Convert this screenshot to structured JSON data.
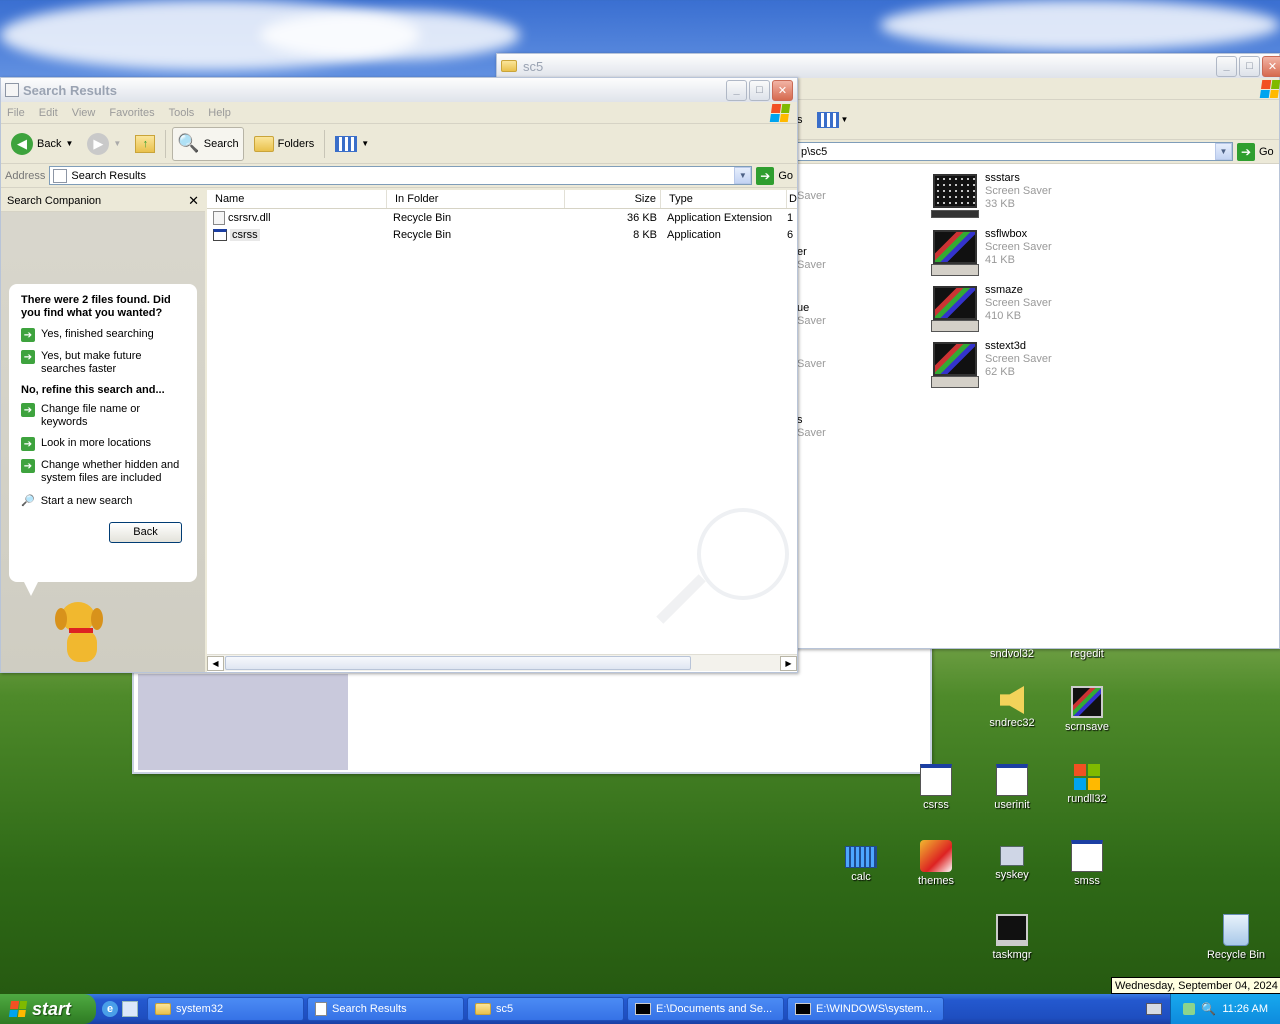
{
  "search_window": {
    "title": "Search Results",
    "menu": [
      "File",
      "Edit",
      "View",
      "Favorites",
      "Tools",
      "Help"
    ],
    "toolbar": {
      "back": "Back",
      "search": "Search",
      "folders": "Folders"
    },
    "address_label": "Address",
    "address_value": "Search Results",
    "go_label": "Go",
    "companion_title": "Search Companion",
    "companion": {
      "found_text": "There were 2 files found. Did you find what you wanted?",
      "yes_finished": "Yes, finished searching",
      "yes_faster": "Yes, but make future searches faster",
      "refine_title": "No, refine this search and...",
      "change_name": "Change file name or keywords",
      "look_more": "Look in more locations",
      "change_hidden": "Change whether hidden and system files are included",
      "start_new": "Start a new search",
      "back_button": "Back"
    },
    "columns": [
      "Name",
      "In Folder",
      "Size",
      "Type",
      "D"
    ],
    "rows": [
      {
        "name": "csrsrv.dll",
        "folder": "Recycle Bin",
        "size": "36 KB",
        "type": "Application Extension",
        "d": "1"
      },
      {
        "name": "csrss",
        "folder": "Recycle Bin",
        "size": "8 KB",
        "type": "Application",
        "d": "6"
      }
    ]
  },
  "sc5_window": {
    "title": "sc5",
    "address_fragment": "p\\sc5",
    "go_label": "Go",
    "toolbar_fragment": "s",
    "left_fragments": [
      {
        "line1": "",
        "line2": "Saver"
      },
      {
        "line1": "er",
        "line2": "Saver"
      },
      {
        "line1": "ue",
        "line2": "Saver"
      },
      {
        "line1": "",
        "line2": "Saver"
      },
      {
        "line1": "s",
        "line2": "Saver"
      }
    ],
    "items": [
      {
        "name": "ssstars",
        "type": "Screen Saver",
        "size": "33 KB"
      },
      {
        "name": "ssflwbox",
        "type": "Screen Saver",
        "size": "41 KB"
      },
      {
        "name": "ssmaze",
        "type": "Screen Saver",
        "size": "410 KB"
      },
      {
        "name": "sstext3d",
        "type": "Screen Saver",
        "size": "62 KB"
      }
    ]
  },
  "desktop_icons": {
    "sndvol32": "sndvol32",
    "regedit": "regedit",
    "sndrec32": "sndrec32",
    "scrnsave": "scrnsave",
    "csrss": "csrss",
    "userinit": "userinit",
    "rundll32": "rundll32",
    "calc": "calc",
    "themes": "themes",
    "syskey": "syskey",
    "smss": "smss",
    "taskmgr": "taskmgr",
    "recycle_bin": "Recycle Bin"
  },
  "tooltip_date": "Wednesday, September 04, 2024",
  "taskbar": {
    "start": "start",
    "items": [
      "system32",
      "Search Results",
      "sc5",
      "E:\\Documents and Se...",
      "E:\\WINDOWS\\system..."
    ],
    "clock": "11:26 AM"
  },
  "colors": {
    "xp_blue": "#2459cf",
    "start_green": "#3b8e2e",
    "tray_blue": "#0e8bdd"
  }
}
